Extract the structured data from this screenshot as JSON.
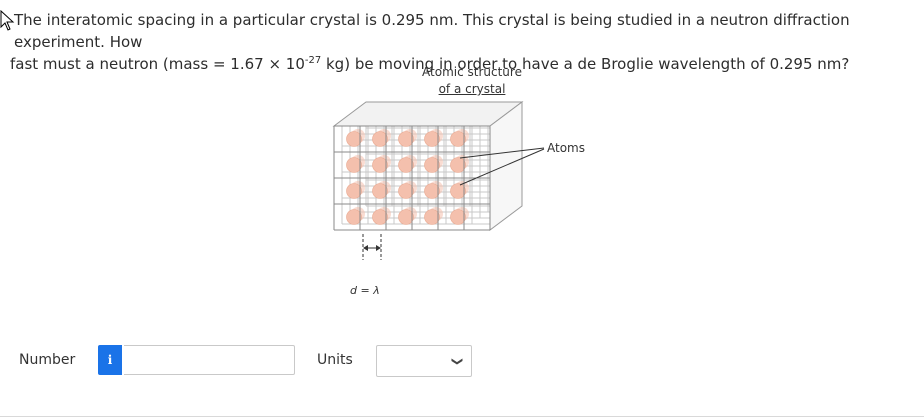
{
  "question": {
    "line1": "The interatomic spacing in a particular crystal is 0.295 nm. This crystal is being studied in a neutron diffraction experiment. How",
    "line2_pre": "fast must a neutron (mass = 1.67 × 10",
    "line2_exp": "-27",
    "line2_post": " kg) be moving in order to have a de Broglie wavelength of 0.295 nm?"
  },
  "figure": {
    "title_line1": "Atomic structure",
    "title_line2": "of a crystal",
    "atoms_label": "Atoms",
    "d_label": "d = λ"
  },
  "form": {
    "number_label": "Number",
    "info_icon_text": "i",
    "number_value": "",
    "units_label": "Units",
    "units_selected": ""
  },
  "colors": {
    "info_button": "#1a73e8",
    "atom": "#f4c0ad"
  }
}
